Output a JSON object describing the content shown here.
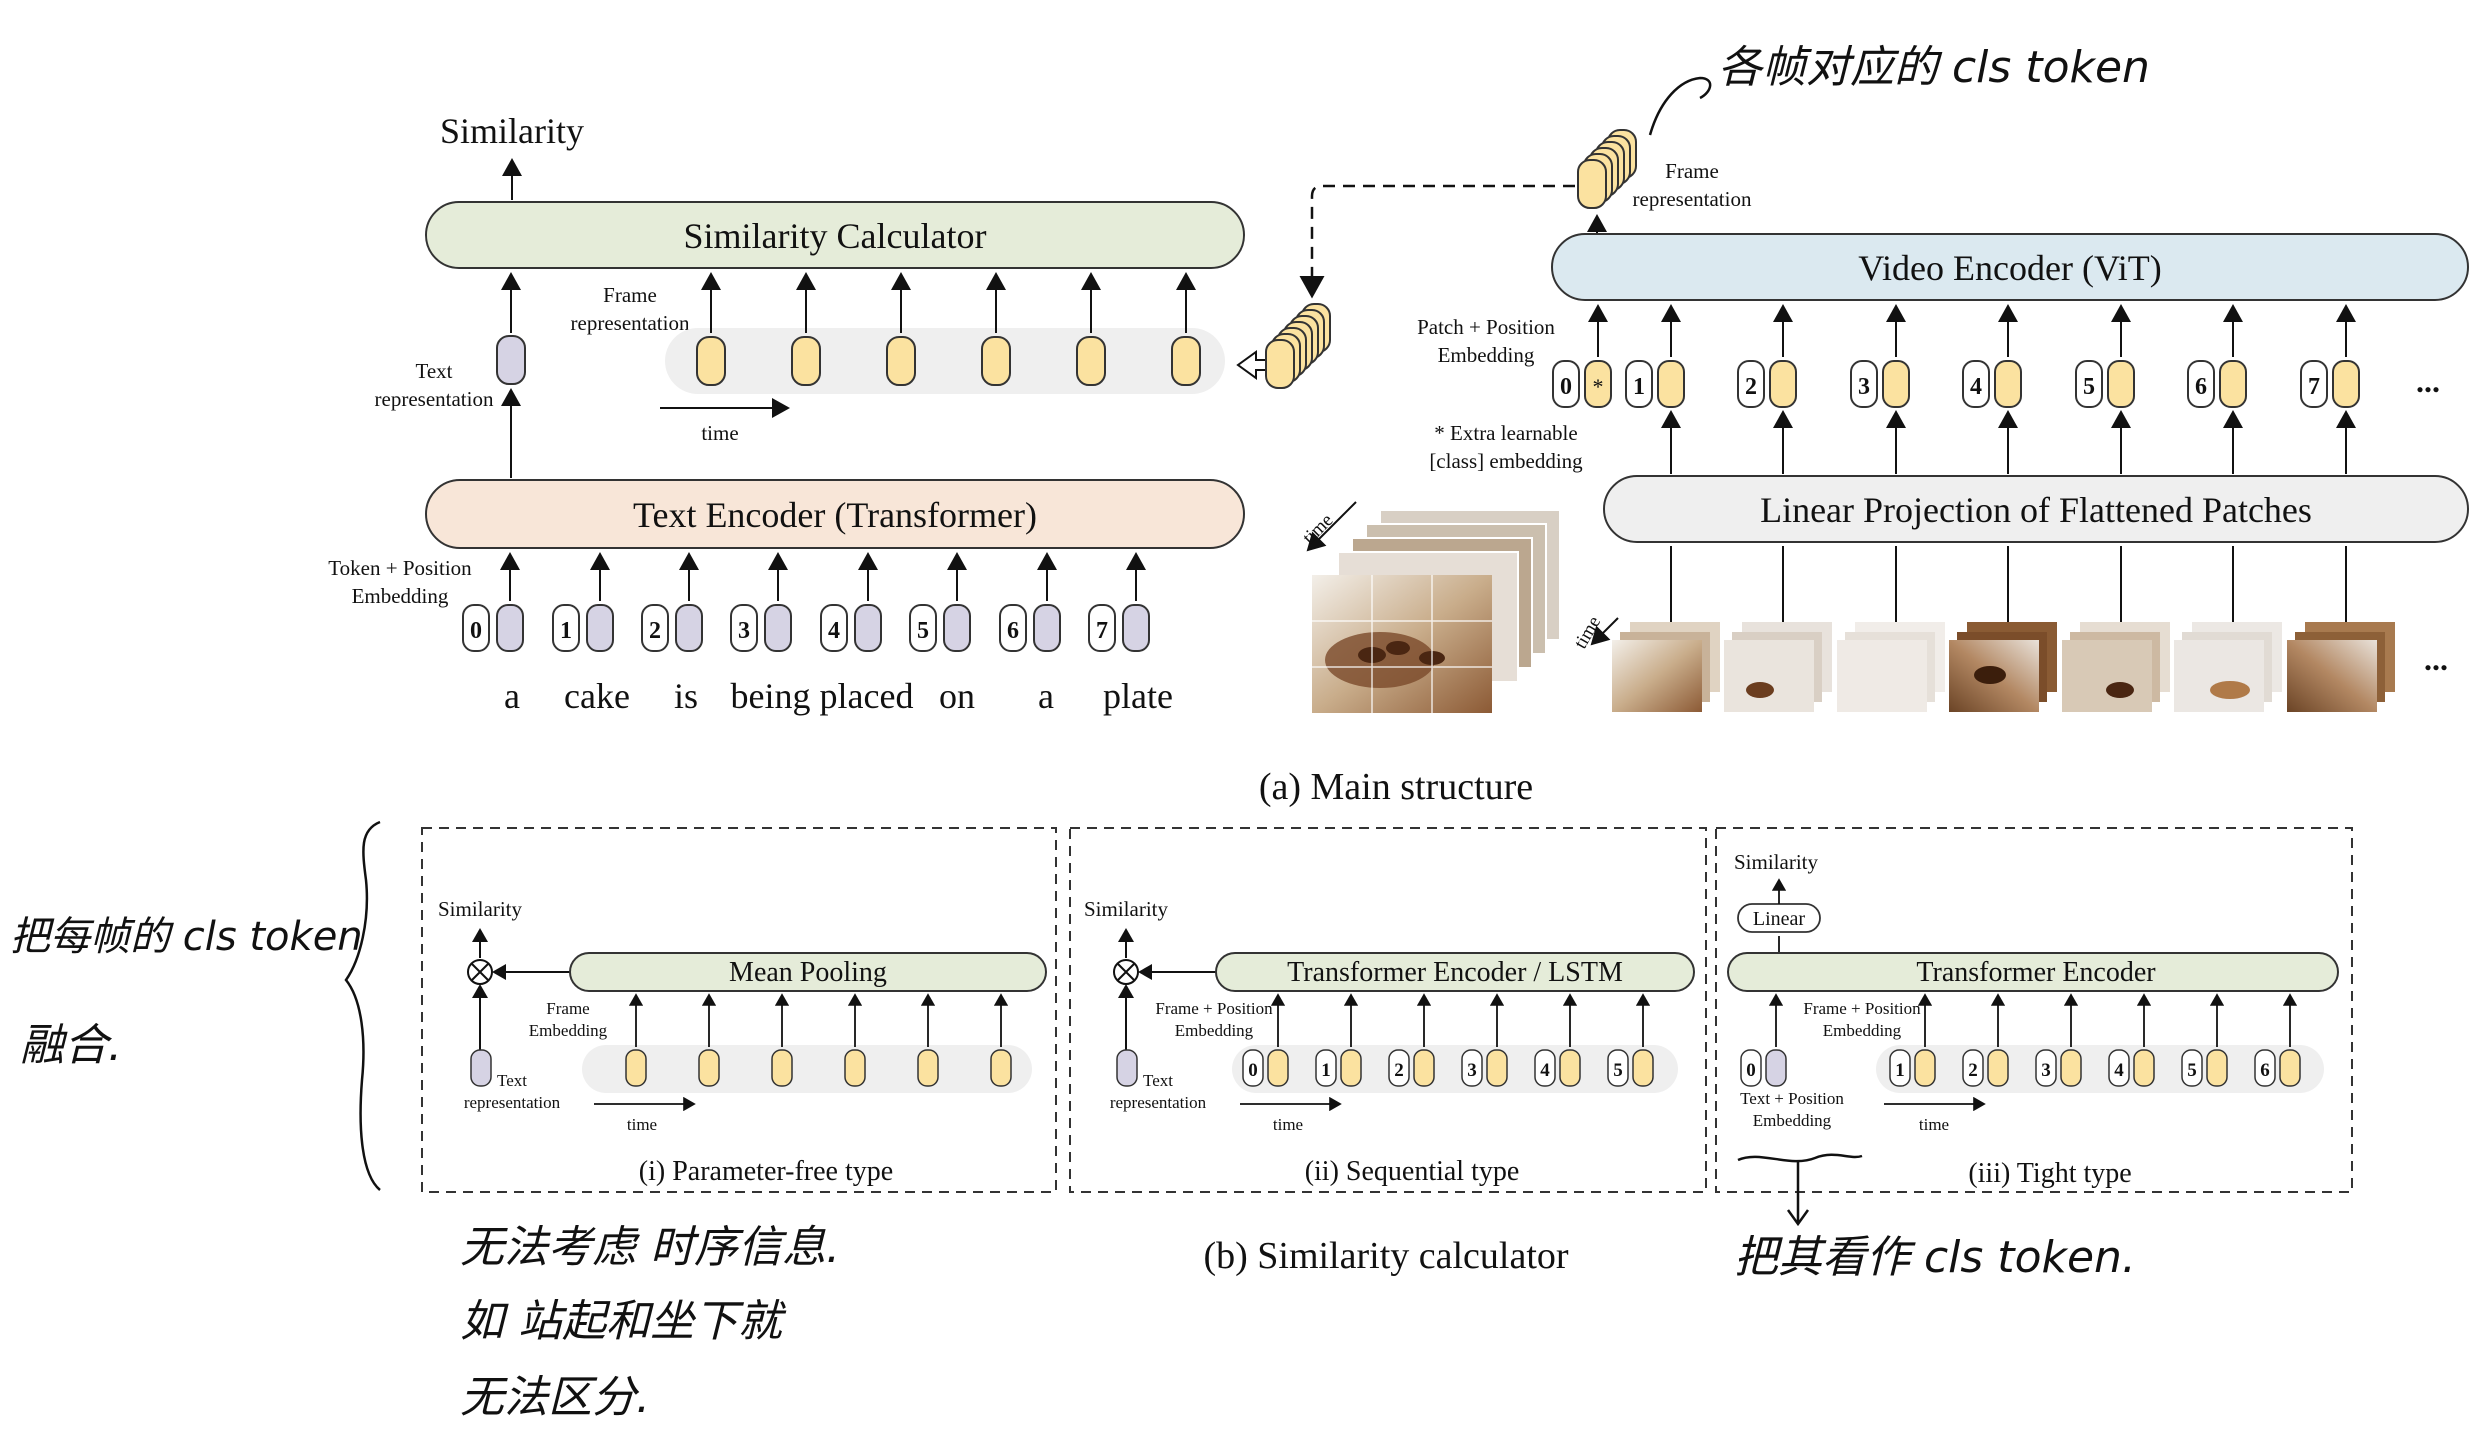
{
  "main": {
    "output_label": "Similarity",
    "sim_calc_label": "Similarity Calculator",
    "frame_repr_label_1": "Frame",
    "frame_repr_label_2": "representation",
    "text_repr_label_1": "Text",
    "text_repr_label_2": "representation",
    "time_label": "time",
    "text_encoder_label": "Text Encoder (Transformer)",
    "token_pos_label_1": "Token + Position",
    "token_pos_label_2": "Embedding",
    "token_indices": [
      "0",
      "1",
      "2",
      "3",
      "4",
      "5",
      "6",
      "7"
    ],
    "caption_words": [
      "a",
      "cake",
      "is",
      "being placed",
      "on",
      "a",
      "plate"
    ],
    "video_frame_repr_1": "Frame",
    "video_frame_repr_2": "representation",
    "video_encoder_label": "Video Encoder (ViT)",
    "patch_pos_label_1": "Patch + Position",
    "patch_pos_label_2": "Embedding",
    "patch_indices": [
      "0",
      "1",
      "2",
      "3",
      "4",
      "5",
      "6",
      "7"
    ],
    "class_token_mark": "*",
    "extra_label_1": "* Extra learnable",
    "extra_label_2": "[class] embedding",
    "linear_proj_label": "Linear Projection of Flattened Patches",
    "ellipsis": "...",
    "section_caption": "(a) Main structure"
  },
  "sub": {
    "caption": "(b) Similarity calculator",
    "panels": [
      {
        "similarity": "Similarity",
        "module": "Mean Pooling",
        "frame_label_1": "Frame",
        "frame_label_2": "Embedding",
        "text_label_1": "Text",
        "text_label_2": "representation",
        "time": "time",
        "caption": "(i) Parameter-free type"
      },
      {
        "similarity": "Similarity",
        "module": "Transformer Encoder / LSTM",
        "frame_label_1": "Frame + Position",
        "frame_label_2": "Embedding",
        "text_label_1": "Text",
        "text_label_2": "representation",
        "time": "time",
        "indices": [
          "0",
          "1",
          "2",
          "3",
          "4",
          "5"
        ],
        "caption": "(ii) Sequential type"
      },
      {
        "similarity": "Similarity",
        "linear": "Linear",
        "module": "Transformer Encoder",
        "frame_label_1": "Frame + Position",
        "frame_label_2": "Embedding",
        "text_label_1": "Text + Position",
        "text_label_2": "Embedding",
        "text_index": "0",
        "time": "time",
        "indices": [
          "1",
          "2",
          "3",
          "4",
          "5",
          "6"
        ],
        "caption": "(iii) Tight type"
      }
    ]
  },
  "annotations": {
    "top_right": "各帧对应的 cls token",
    "left_1": "把每帧的 cls token",
    "left_2": "融合.",
    "bottom_1": "无法考虑 时序信息.",
    "bottom_2": "如 站起和坐下就",
    "bottom_3": "无法区分.",
    "bottom_right": "把其看作 cls token."
  },
  "colors": {
    "sim_calc": "#e5ecd9",
    "text_encoder": "#f8e6d8",
    "video_encoder": "#dbe9f0",
    "linear_proj": "#efefef",
    "frame_token": "#fbe2a0",
    "text_token": "#d6d3e4",
    "band": "#efefef"
  }
}
